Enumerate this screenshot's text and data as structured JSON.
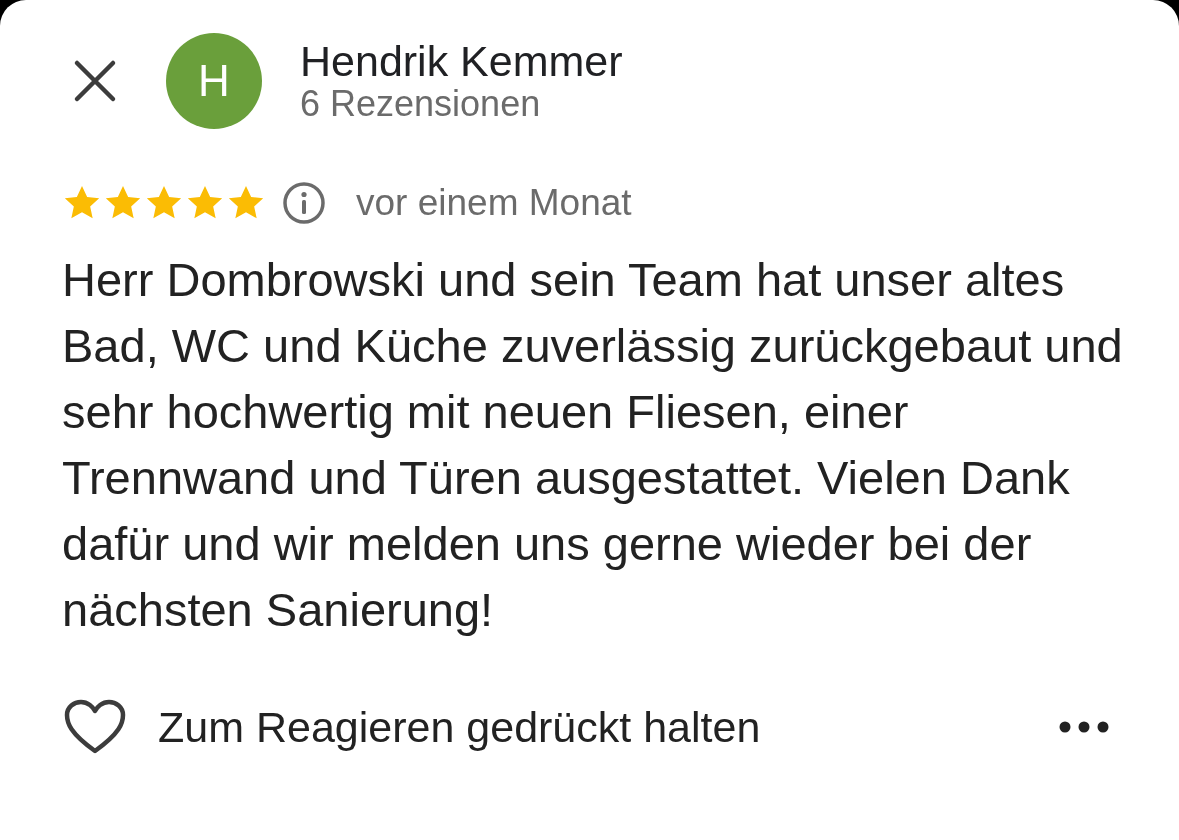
{
  "reviewer": {
    "initial": "H",
    "name": "Hendrik Kemmer",
    "review_count": "6 Rezensionen"
  },
  "rating": {
    "stars": 5,
    "time": "vor einem Monat"
  },
  "review_text": "Herr Dombrowski und sein Team hat unser altes Bad, WC und Küche zuverlässig zurückgebaut und sehr hochwertig mit neuen Fliesen, einer Trennwand und Türen ausgestattet. Vielen Dank dafür und wir melden uns gerne wieder bei der nächsten Sanierung!",
  "reaction": {
    "hint": "Zum Reagieren gedrückt halten"
  }
}
